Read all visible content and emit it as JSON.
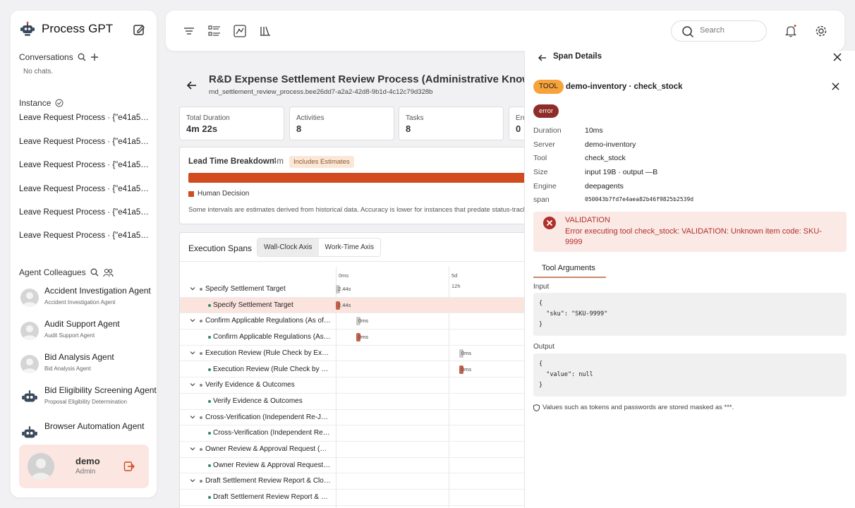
{
  "app": {
    "title": "Process GPT"
  },
  "sidebar": {
    "conversations_label": "Conversations",
    "no_chats": "No chats.",
    "instance_label": "Instance",
    "instances": [
      "Leave Request Process · {\"e41a53e...",
      "Leave Request Process · {\"e41a53e...",
      "Leave Request Process · {\"e41a53e...",
      "Leave Request Process · {\"e41a53e...",
      "Leave Request Process · {\"e41a53e...",
      "Leave Request Process · {\"e41a53e..."
    ],
    "agents_label": "Agent Colleagues",
    "agents": [
      {
        "name": "Accident Investigation Agent",
        "role": "Accident Investigation Agent"
      },
      {
        "name": "Audit Support Agent",
        "role": "Audit Support Agent"
      },
      {
        "name": "Bid Analysis Agent",
        "role": "Bid Analysis Agent"
      },
      {
        "name": "Bid Eligibility Screening Agent",
        "role": "Proposal Eligibility Determination"
      },
      {
        "name": "Browser Automation Agent",
        "role": ""
      }
    ],
    "user": {
      "name": "demo",
      "role": "Admin"
    }
  },
  "topbar": {
    "search_placeholder": "Search"
  },
  "process": {
    "title": "R&D Expense Settlement Review Process (Administrative Knowledge)",
    "id": "rnd_settlement_review_process.bee26dd7-a2a2-42d8-9b1d-4c12c79d328b",
    "stats": [
      {
        "label": "Total Duration",
        "value": "4m 22s"
      },
      {
        "label": "Activities",
        "value": "8"
      },
      {
        "label": "Tasks",
        "value": "8"
      },
      {
        "label": "Errors",
        "value": "0"
      }
    ],
    "lead_time": {
      "title": "Lead Time Breakdown",
      "value": "4m",
      "badge": "Includes Estimates",
      "legend": "Human Decision",
      "note": "Some intervals are estimates derived from historical data. Accuracy is lower for instances that predate status-tracking."
    },
    "spans": {
      "title": "Execution Spans",
      "axis_tabs": [
        "Wall-Clock Axis",
        "Work-Time Axis"
      ],
      "ticks": {
        "t0": "0ms",
        "t1": "5d",
        "t1b": "12h"
      },
      "rows": [
        {
          "label": "Specify Settlement Target",
          "dur": "2.44s",
          "parent": true
        },
        {
          "label": "Specify Settlement Target",
          "dur": "2.44s",
          "parent": false
        },
        {
          "label": "Confirm Applicable Regulations (As of Date)",
          "dur": "0ms",
          "parent": true
        },
        {
          "label": "Confirm Applicable Regulations (As of Date)",
          "dur": "0ms",
          "parent": false
        },
        {
          "label": "Execution Review (Rule Check by Expense Item)",
          "dur": "0ms",
          "parent": true
        },
        {
          "label": "Execution Review (Rule Check by Expense Item)",
          "dur": "0ms",
          "parent": false
        },
        {
          "label": "Verify Evidence & Outcomes",
          "dur": "",
          "parent": true
        },
        {
          "label": "Verify Evidence & Outcomes",
          "dur": "",
          "parent": false
        },
        {
          "label": "Cross-Verification (Independent Re-Judgment)",
          "dur": "",
          "parent": true
        },
        {
          "label": "Cross-Verification (Independent Re-Judgment)",
          "dur": "",
          "parent": false
        },
        {
          "label": "Owner Review & Approval Request (Final)",
          "dur": "",
          "parent": true
        },
        {
          "label": "Owner Review & Approval Request (Final)",
          "dur": "",
          "parent": false
        },
        {
          "label": "Draft Settlement Review Report & Close",
          "dur": "",
          "parent": true
        },
        {
          "label": "Draft Settlement Review Report & Close",
          "dur": "",
          "parent": false
        }
      ]
    }
  },
  "panel": {
    "title": "Span Details",
    "tool_badge": "TOOL",
    "tool_name": "demo-inventory · check_stock",
    "status": "error",
    "fields": [
      {
        "k": "Duration",
        "v": "10ms"
      },
      {
        "k": "Server",
        "v": "demo-inventory"
      },
      {
        "k": "Tool",
        "v": "check_stock"
      },
      {
        "k": "Size",
        "v": "input 19B · output —B"
      },
      {
        "k": "Engine",
        "v": "deepagents"
      },
      {
        "k": "span",
        "v": "050043b7fd7e4aea82b46f9825b2539d"
      }
    ],
    "error_title": "VALIDATION",
    "error_message": "Error executing tool check_stock: VALIDATION: Unknown item code: SKU-9999",
    "args_tab": "Tool Arguments",
    "input_label": "Input",
    "input_code": "{\n  \"sku\": \"SKU-9999\"\n}",
    "output_label": "Output",
    "output_code": "{\n  \"value\": null\n}",
    "mask_note": "Values such as tokens and passwords are stored masked as ***."
  },
  "colors": {
    "accent": "#d24a1f",
    "tool_badge": "#f7a23b",
    "error": "#8e2d28",
    "highlight": "#fbe4de"
  }
}
